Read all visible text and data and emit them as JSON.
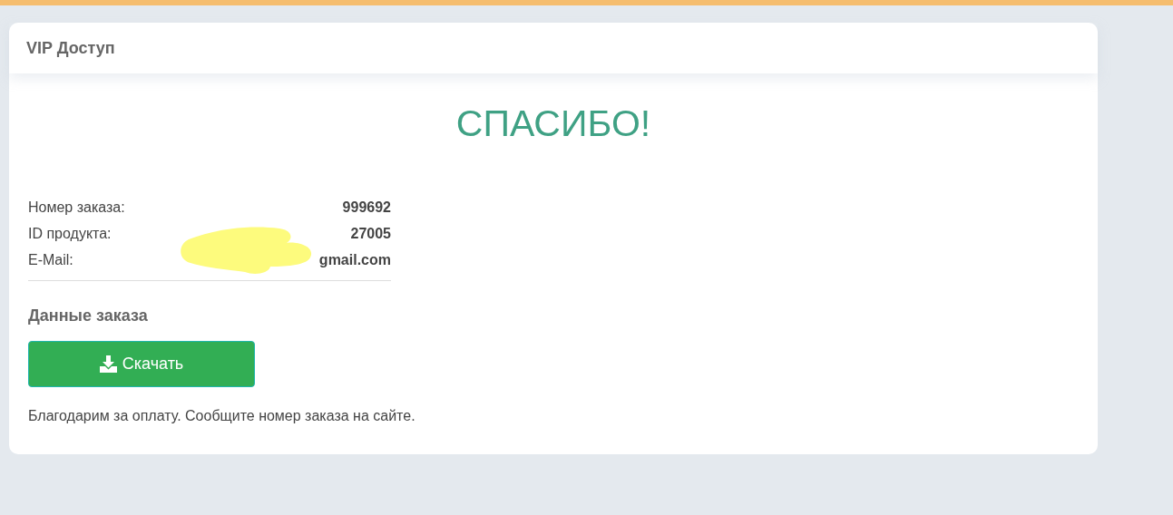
{
  "card": {
    "title": "VIP Доступ"
  },
  "heading": "СПАСИБО!",
  "details": [
    {
      "label": "Номер заказа:",
      "value": "999692",
      "redacted": false
    },
    {
      "label": "ID продукта:",
      "value": "27005",
      "redacted": false
    },
    {
      "label": "E-Mail:",
      "value": "gmail.com",
      "redacted": true
    }
  ],
  "section_title": "Данные заказа",
  "download_button": "Скачать",
  "note": "Благодарим за оплату. Сообщите номер заказа на сайте."
}
